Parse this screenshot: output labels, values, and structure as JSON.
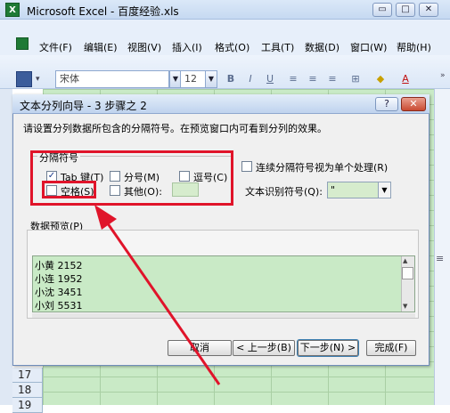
{
  "app": {
    "title": "Microsoft Excel - 百度经验.xls",
    "icon": "excel-icon",
    "window_buttons": [
      "▭",
      "□",
      "✕"
    ]
  },
  "menu": {
    "items": [
      "文件(F)",
      "编辑(E)",
      "视图(V)",
      "插入(I)",
      "格式(O)",
      "工具(T)",
      "数据(D)",
      "窗口(W)",
      "帮助(H)"
    ],
    "window_controls": [
      "_",
      "♂",
      "×"
    ]
  },
  "toolbar": {
    "font_name": "宋体",
    "font_size": "12",
    "format_buttons": [
      "B",
      "I",
      "U"
    ],
    "icons": [
      "save-icon",
      "bold-icon",
      "italic-icon",
      "underline-icon",
      "align-left-icon",
      "align-center-icon",
      "align-right-icon",
      "borders-icon",
      "fill-color-icon",
      "font-color-icon"
    ]
  },
  "sheet": {
    "row_numbers": [
      "17",
      "18",
      "19"
    ]
  },
  "dialog": {
    "title": "文本分列向导 - 3 步骤之 2",
    "help_label": "?",
    "close_label": "✕",
    "instruction": "请设置分列数据所包含的分隔符号。在预览窗口内可看到分列的效果。",
    "delimiters": {
      "title": "分隔符号",
      "options": [
        {
          "label": "Tab 键(T)",
          "checked": true
        },
        {
          "label": "分号(M)",
          "checked": false
        },
        {
          "label": "逗号(C)",
          "checked": false
        },
        {
          "label": "空格(S)",
          "checked": false
        },
        {
          "label": "其他(O):",
          "checked": false
        }
      ]
    },
    "consecutive": {
      "label": "连续分隔符号视为单个处理(R)",
      "checked": false
    },
    "text_qualifier": {
      "label": "文本识别符号(Q):",
      "value": "\""
    },
    "preview": {
      "label": "数据预览(P)",
      "lines": [
        "小黄 2152",
        "小连 1952",
        "小沈 3451",
        "小刘 5531"
      ]
    },
    "buttons": {
      "cancel": "取消",
      "back": "< 上一步(B)",
      "next": "下一步(N) >",
      "finish": "完成(F)"
    },
    "annotation_color": "#e0142a"
  }
}
